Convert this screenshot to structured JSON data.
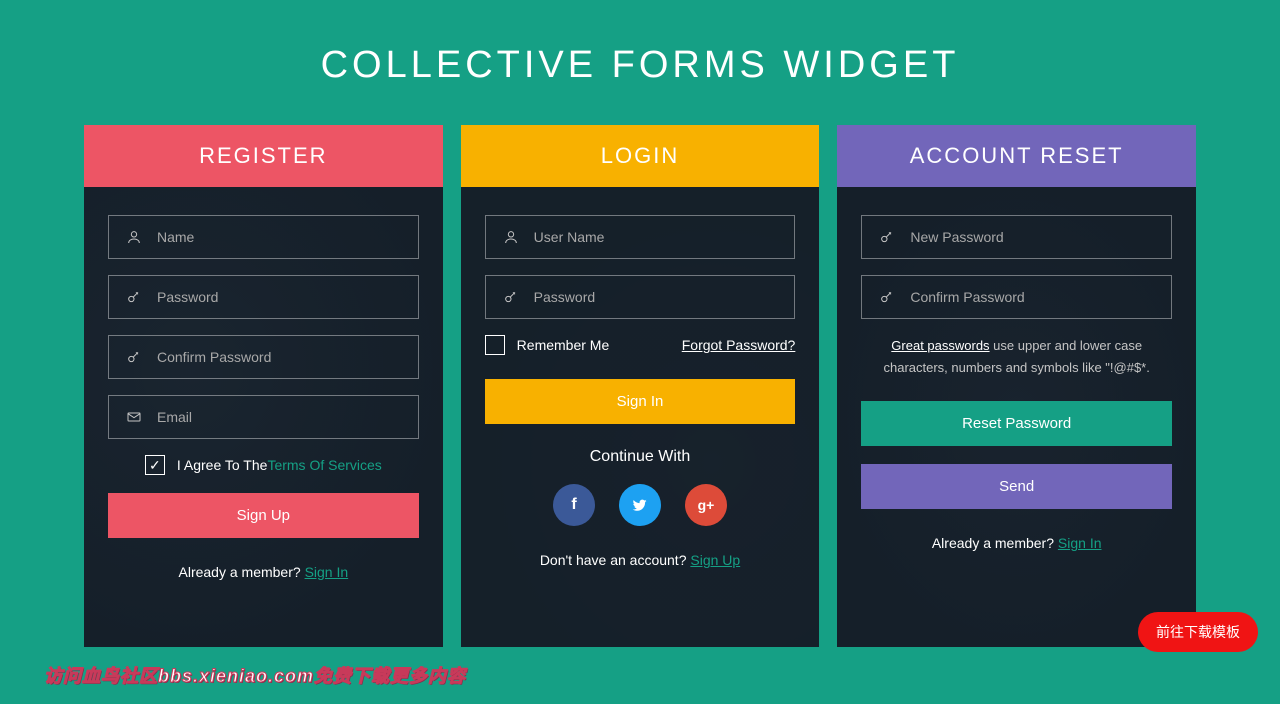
{
  "title": "COLLECTIVE FORMS WIDGET",
  "register": {
    "header": "REGISTER",
    "name_ph": "Name",
    "password_ph": "Password",
    "confirm_ph": "Confirm Password",
    "email_ph": "Email",
    "agree_prefix": "I Agree To The ",
    "terms": "Terms Of Services",
    "submit": "Sign Up",
    "footer_q": "Already a member? ",
    "footer_link": "Sign In"
  },
  "login": {
    "header": "LOGIN",
    "user_ph": "User Name",
    "password_ph": "Password",
    "remember": "Remember Me",
    "forgot": "Forgot Password?",
    "submit": "Sign In",
    "continue": "Continue With",
    "footer_q": "Don't have an account? ",
    "footer_link": "Sign Up"
  },
  "reset": {
    "header": "ACCOUNT RESET",
    "new_ph": "New Password",
    "confirm_ph": "Confirm Password",
    "hint_bold": "Great passwords",
    "hint_rest": " use upper and lower case characters, numbers and symbols like \"!@#$*.",
    "reset_btn": "Reset Password",
    "send_btn": "Send",
    "footer_q": "Already a member? ",
    "footer_link": "Sign In"
  },
  "download_btn": "前往下载模板",
  "watermark": "访问血鸟社区bbs.xieniao.com免费下载更多内容",
  "colors": {
    "teal": "#15a085",
    "red": "#ed5565",
    "yellow": "#f8b100",
    "purple": "#7266ba"
  }
}
